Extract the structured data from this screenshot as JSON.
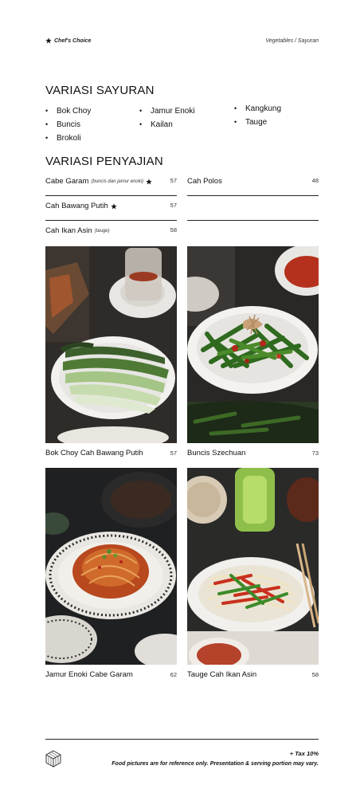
{
  "header": {
    "brand_label": "Chef's Choice",
    "category": "Vegetables / Sayuran"
  },
  "vegetables": {
    "title": "VARIASI SAYURAN",
    "columns": [
      [
        "Bok Choy",
        "Buncis",
        "Brokoli"
      ],
      [
        "Jamur Enoki",
        "Kailan"
      ],
      [
        "Kangkung",
        "Tauge"
      ]
    ]
  },
  "preparations": {
    "title": "VARIASI PENYAJIAN",
    "left": [
      {
        "name": "Cabe Garam",
        "note": "(buncis dan jamur enoki)",
        "starred": true,
        "price": "57"
      },
      {
        "name": "Cah Bawang Putih",
        "note": "",
        "starred": true,
        "price": "57"
      },
      {
        "name": "Cah Ikan Asin",
        "note": "(tauge)",
        "starred": false,
        "price": "58"
      }
    ],
    "right": [
      {
        "name": "Cah Polos",
        "price": "48"
      }
    ]
  },
  "dishes": [
    {
      "name": "Bok Choy Cah Bawang Putih",
      "price": "57"
    },
    {
      "name": "Buncis Szechuan",
      "price": "73"
    },
    {
      "name": "Jamur Enoki Cabe Garam",
      "price": "62"
    },
    {
      "name": "Tauge Cah Ikan Asin",
      "price": "58"
    }
  ],
  "footer": {
    "tax": "+ Tax 10%",
    "disclaimer": "Food pictures are for reference only. Presentation & serving portion may vary.",
    "logo_icon": "hexagon-cube-logo-icon"
  }
}
